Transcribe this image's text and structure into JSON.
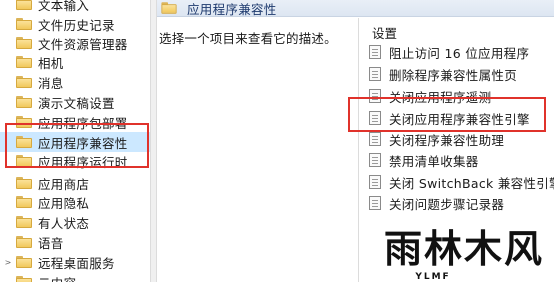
{
  "tree": {
    "items": [
      {
        "label": "文本输入",
        "expander": "",
        "selected": false
      },
      {
        "label": "文件历史记录",
        "expander": "",
        "selected": false
      },
      {
        "label": "文件资源管理器",
        "expander": "",
        "selected": false
      },
      {
        "label": "相机",
        "expander": "",
        "selected": false
      },
      {
        "label": "消息",
        "expander": "",
        "selected": false
      },
      {
        "label": "演示文稿设置",
        "expander": "",
        "selected": false
      },
      {
        "label": "应用程序包部署",
        "expander": "",
        "selected": false
      },
      {
        "label": "应用程序兼容性",
        "expander": "",
        "selected": true
      },
      {
        "label": "应用程序运行时",
        "expander": "",
        "selected": false
      },
      {
        "label": "应用商店",
        "expander": "",
        "selected": false
      },
      {
        "label": "应用隐私",
        "expander": "",
        "selected": false
      },
      {
        "label": "有人状态",
        "expander": "",
        "selected": false
      },
      {
        "label": "语音",
        "expander": "",
        "selected": false
      },
      {
        "label": "远程桌面服务",
        "expander": ">",
        "selected": false
      },
      {
        "label": "云内容",
        "expander": "",
        "selected": false
      }
    ]
  },
  "right": {
    "header_title": "应用程序兼容性",
    "description": "选择一个项目来查看它的描述。",
    "settings_header": "设置",
    "settings": [
      {
        "label": "阻止访问 16 位应用程序"
      },
      {
        "label": "删除程序兼容性属性页"
      },
      {
        "label": "关闭应用程序遥测"
      },
      {
        "label": "关闭应用程序兼容性引擎"
      },
      {
        "label": "关闭程序兼容性助理"
      },
      {
        "label": "禁用清单收集器"
      },
      {
        "label": "关闭 SwitchBack 兼容性引擎"
      },
      {
        "label": "关闭问题步骤记录器"
      }
    ]
  },
  "watermark": {
    "text": "雨林木风",
    "sub": "YLMF"
  },
  "colors": {
    "highlight": "#e0322b",
    "selection": "#cce8ff",
    "header_text": "#1e3a6e"
  }
}
